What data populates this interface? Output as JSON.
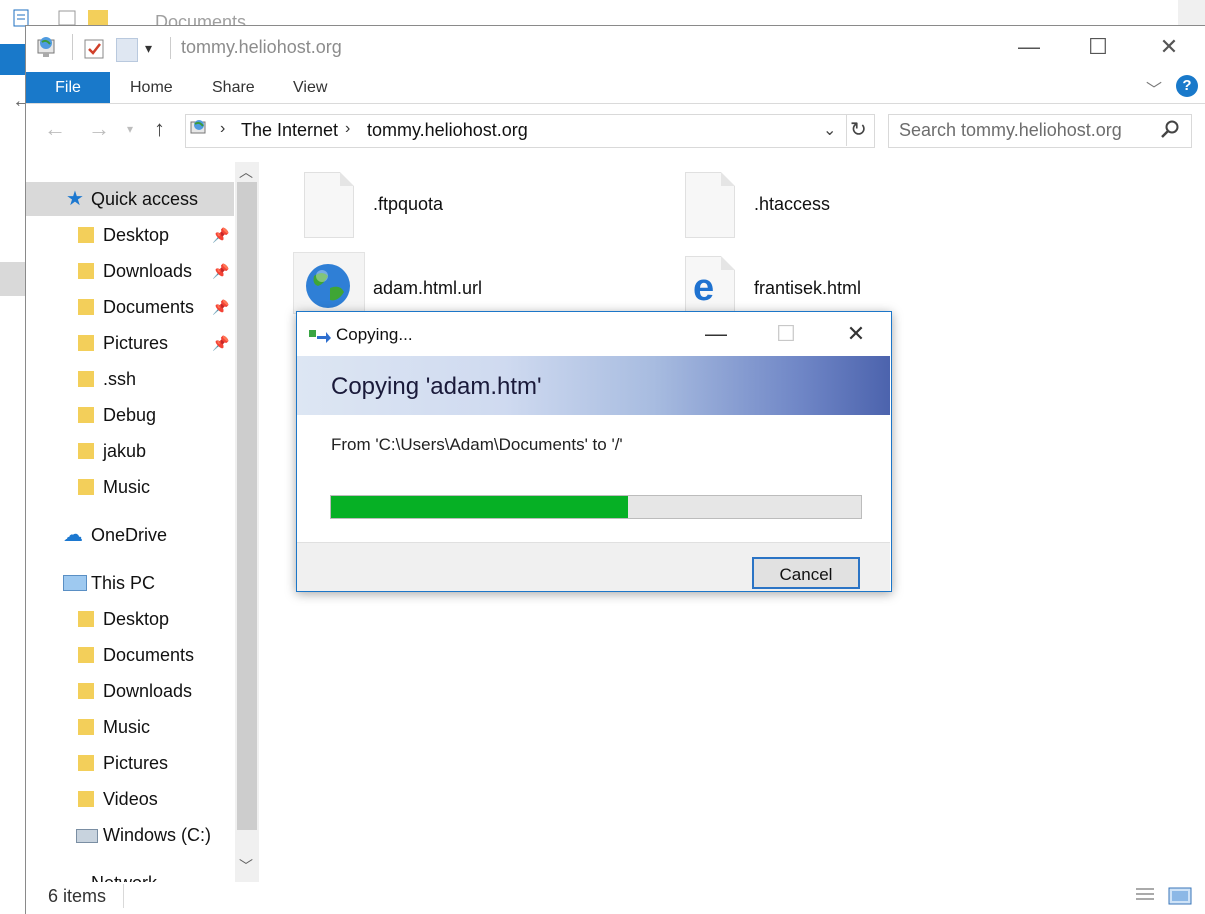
{
  "background_window": {
    "title": "Documents"
  },
  "window": {
    "title": "tommy.heliohost.org",
    "minimize_glyph": "—",
    "maximize_glyph": "☐",
    "close_glyph": "✕"
  },
  "ribbon": {
    "tabs": [
      "File",
      "Home",
      "Share",
      "View"
    ],
    "help_glyph": "?"
  },
  "address_bar": {
    "breadcrumbs": [
      "The Internet",
      "tommy.heliohost.org"
    ],
    "search_placeholder": "Search tommy.heliohost.org"
  },
  "navigation": {
    "quick_access": "Quick access",
    "quick_items": [
      {
        "label": "Desktop",
        "pinned": true
      },
      {
        "label": "Downloads",
        "pinned": true
      },
      {
        "label": "Documents",
        "pinned": true
      },
      {
        "label": "Pictures",
        "pinned": true
      },
      {
        "label": ".ssh",
        "pinned": false
      },
      {
        "label": "Debug",
        "pinned": false
      },
      {
        "label": "jakub",
        "pinned": false
      },
      {
        "label": "Music",
        "pinned": false
      }
    ],
    "onedrive": "OneDrive",
    "this_pc": "This PC",
    "pc_items": [
      "Desktop",
      "Documents",
      "Downloads",
      "Music",
      "Pictures",
      "Videos",
      "Windows (C:)"
    ],
    "network_partial": "Network"
  },
  "files": [
    {
      "name": ".ftpquota",
      "icon": "blank-file-icon"
    },
    {
      "name": ".htaccess",
      "icon": "blank-file-icon"
    },
    {
      "name": "adam.html.url",
      "icon": "globe-icon"
    },
    {
      "name": "frantisek.html",
      "icon": "edge-icon"
    }
  ],
  "status_bar": {
    "item_count": "6 items"
  },
  "copy_dialog": {
    "title": "Copying...",
    "heading": "Copying 'adam.htm'",
    "from_text": "From 'C:\\Users\\Adam\\Documents' to '/'",
    "progress": 0.56,
    "cancel_label": "Cancel",
    "progress_color": "#06b025"
  },
  "colors": {
    "accent": "#1979ca",
    "selection": "#d9d9d9"
  }
}
